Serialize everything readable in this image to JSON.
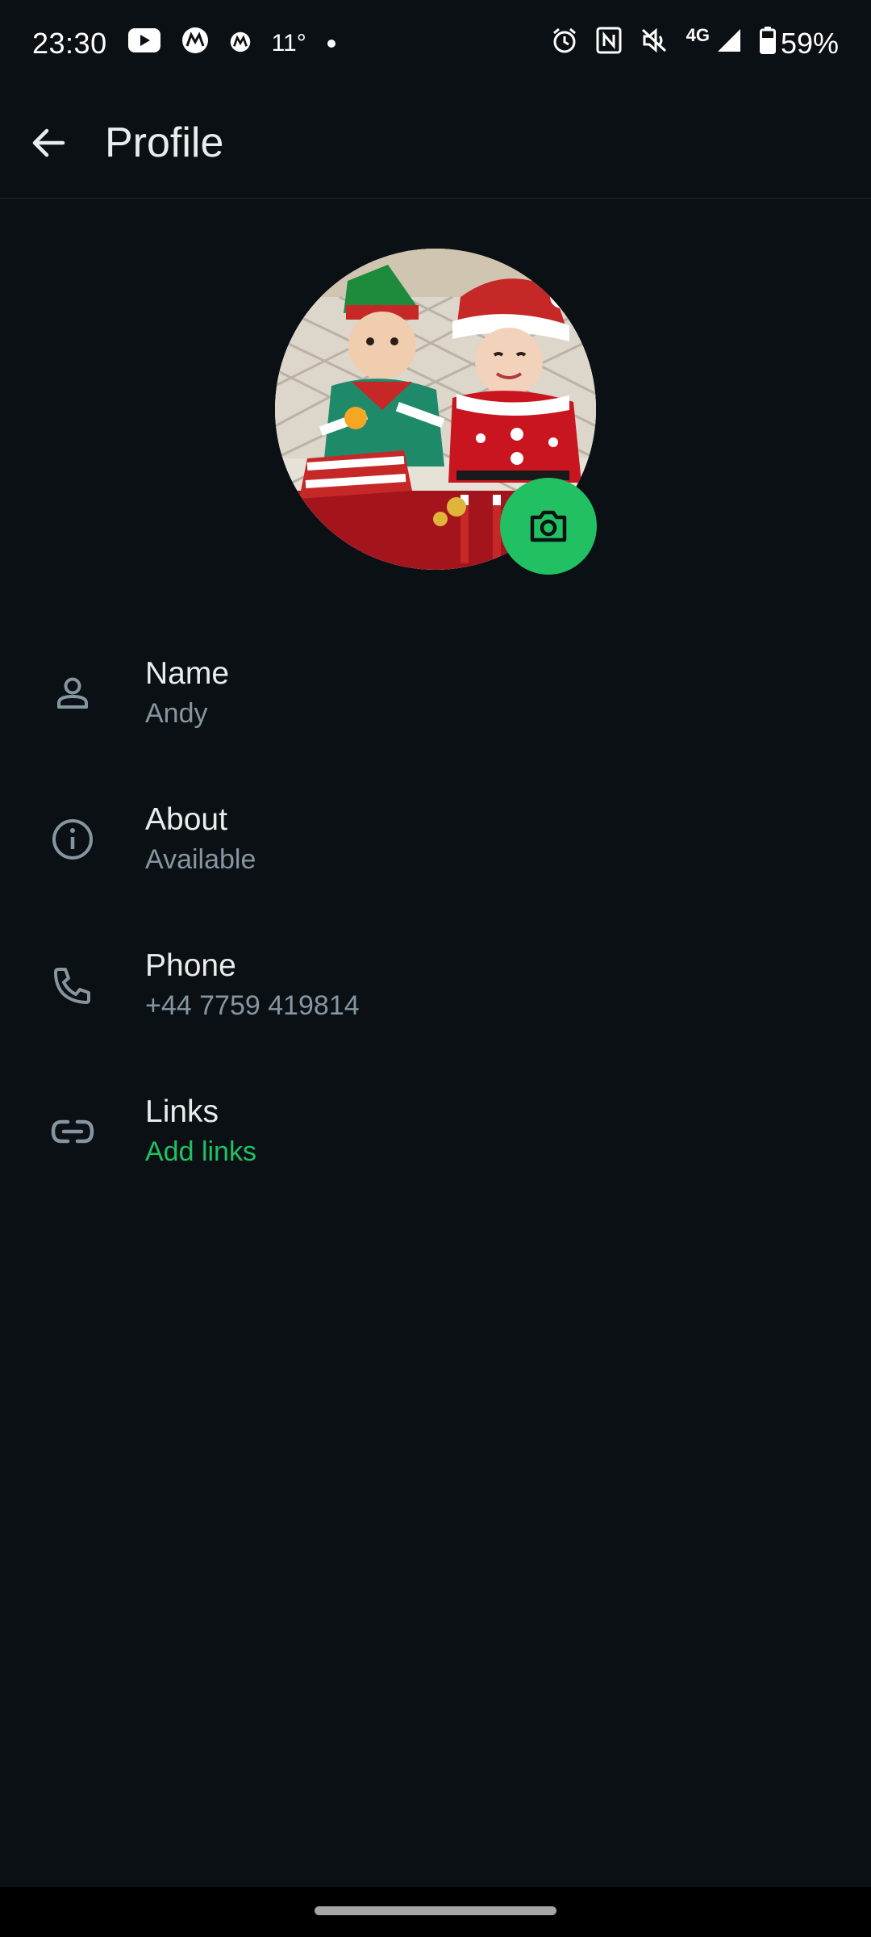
{
  "status_bar": {
    "time": "23:30",
    "temperature": "11°",
    "network": "4G",
    "battery": "59%",
    "icons": [
      "youtube-icon",
      "motorola-icon",
      "motorola-small-icon",
      "notification-dot",
      "alarm-icon",
      "nfc-icon",
      "vibrate-off-icon",
      "signal-icon",
      "battery-icon"
    ]
  },
  "app_bar": {
    "title": "Profile",
    "back_icon": "arrow-back-icon"
  },
  "avatar": {
    "camera_icon": "camera-icon",
    "accent_color": "#21c063"
  },
  "rows": [
    {
      "icon": "person-icon",
      "label": "Name",
      "value": "Andy"
    },
    {
      "icon": "info-icon",
      "label": "About",
      "value": "Available"
    },
    {
      "icon": "phone-icon",
      "label": "Phone",
      "value": "+44 7759 419814"
    },
    {
      "icon": "link-icon",
      "label": "Links",
      "value": "Add links"
    }
  ],
  "colors": {
    "background": "#0b1014",
    "primary_text": "#e9edef",
    "secondary_text": "#8696a0",
    "accent": "#21c063"
  }
}
